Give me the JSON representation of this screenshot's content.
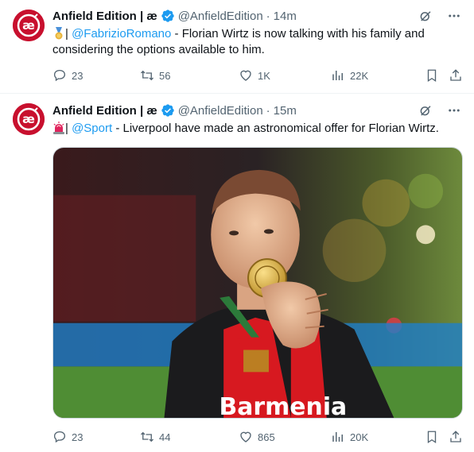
{
  "colors": {
    "accent": "#1d9bf0",
    "secondary_text": "#536471",
    "brand_red": "#c8102e",
    "divider": "#eff3f4"
  },
  "tweets": [
    {
      "display_name": "Anfield Edition | æ",
      "handle": "@AnfieldEdition",
      "separator": "·",
      "time": "14m",
      "emoji": "medal-icon",
      "text_prefix": "| ",
      "mention": "@FabrizioRomano",
      "text": " - Florian Wirtz is now talking with his family and considering the options available to him.",
      "stats": {
        "replies": "23",
        "retweets": "56",
        "likes": "1K",
        "views": "22K"
      }
    },
    {
      "display_name": "Anfield Edition | æ",
      "handle": "@AnfieldEdition",
      "separator": "·",
      "time": "15m",
      "emoji": "siren-icon",
      "text_prefix": "| ",
      "mention": "@Sport",
      "text": " - Liverpool have made an astronomical offer for Florian Wirtz.",
      "stats": {
        "replies": "23",
        "retweets": "44",
        "likes": "865",
        "views": "20K"
      },
      "media": {
        "shirt_text": "Barmenia"
      }
    }
  ]
}
